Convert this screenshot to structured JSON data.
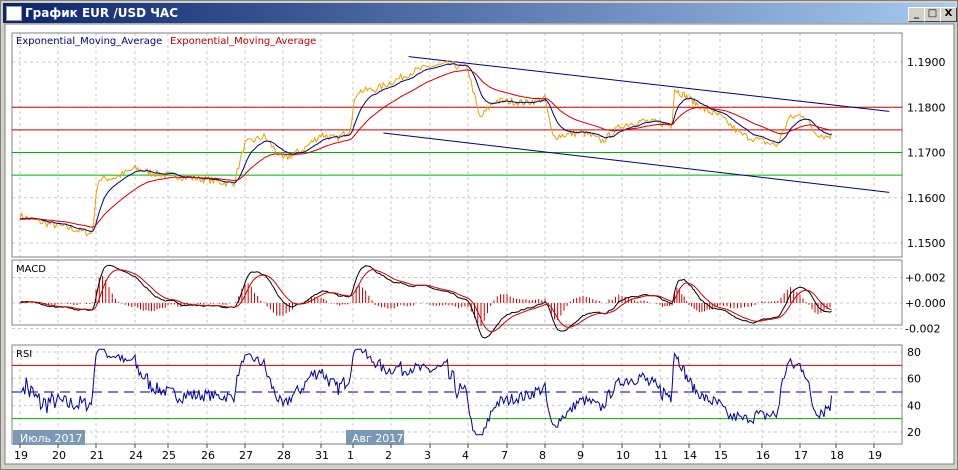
{
  "window": {
    "title": "График EUR /USD  ЧАС",
    "minimize": "_",
    "maximize": "□",
    "close": "X"
  },
  "legend": {
    "ema_blue": "Exponential_Moving_Average",
    "ema_red": "Exponential_Moving_Average"
  },
  "panels": {
    "macd": "MACD",
    "rsi": "RSI"
  },
  "months": [
    {
      "label": "Июль 2017"
    },
    {
      "label": "Авг 2017"
    }
  ],
  "colors": {
    "price": "#e8a000",
    "ema_fast": "#000080",
    "ema_slow": "#d00000",
    "red_level": "#d00000",
    "green_level": "#00b000",
    "channel": "#000080"
  },
  "chart_data": [
    {
      "type": "line",
      "title": "EUR/USD H1",
      "y_ticks": [
        "1.1900",
        "1.1800",
        "1.1700",
        "1.1600",
        "1.1500"
      ],
      "ylim": [
        1.1475,
        1.1965
      ],
      "x_ticks": [
        "19",
        "20",
        "21",
        "24",
        "25",
        "26",
        "27",
        "28",
        "31",
        "1",
        "2",
        "3",
        "4",
        "7",
        "8",
        "9",
        "10",
        "11",
        "14",
        "15",
        "16",
        "17",
        "18",
        "19"
      ],
      "price_keypoints": [
        [
          0,
          1.156
        ],
        [
          0.6,
          1.1545
        ],
        [
          1.2,
          1.1535
        ],
        [
          1.9,
          1.152
        ],
        [
          2.05,
          1.164
        ],
        [
          2.5,
          1.1645
        ],
        [
          3,
          1.1665
        ],
        [
          3.5,
          1.1655
        ],
        [
          4,
          1.165
        ],
        [
          5,
          1.164
        ],
        [
          5.7,
          1.163
        ],
        [
          6,
          1.172
        ],
        [
          6.5,
          1.1735
        ],
        [
          7,
          1.1685
        ],
        [
          7.5,
          1.1705
        ],
        [
          8,
          1.174
        ],
        [
          8.5,
          1.173
        ],
        [
          8.9,
          1.175
        ],
        [
          9.1,
          1.1835
        ],
        [
          9.6,
          1.184
        ],
        [
          10,
          1.1855
        ],
        [
          10.6,
          1.188
        ],
        [
          11,
          1.189
        ],
        [
          11.5,
          1.1895
        ],
        [
          12,
          1.1885
        ],
        [
          12.3,
          1.1775
        ],
        [
          12.7,
          1.1815
        ],
        [
          13.5,
          1.181
        ],
        [
          14,
          1.182
        ],
        [
          14.2,
          1.1735
        ],
        [
          15,
          1.1745
        ],
        [
          15.5,
          1.1725
        ],
        [
          16,
          1.176
        ],
        [
          16.5,
          1.177
        ],
        [
          17,
          1.1765
        ],
        [
          17.4,
          1.176
        ],
        [
          17.5,
          1.184
        ],
        [
          18,
          1.182
        ],
        [
          18.5,
          1.1795
        ],
        [
          19,
          1.178
        ],
        [
          19.5,
          1.174
        ],
        [
          20,
          1.1725
        ],
        [
          20.4,
          1.1715
        ],
        [
          20.7,
          1.1775
        ],
        [
          21.1,
          1.1785
        ],
        [
          21.4,
          1.1745
        ],
        [
          21.7,
          1.1735
        ],
        [
          21.9,
          1.1738
        ]
      ],
      "levels": [
        {
          "value": 1.18,
          "color": "red"
        },
        {
          "value": 1.175,
          "color": "red"
        },
        {
          "value": 1.17,
          "color": "green"
        },
        {
          "value": 1.165,
          "color": "green"
        }
      ],
      "channel": [
        [
          [
            10.45,
            1.1912
          ],
          [
            23.4,
            1.1791
          ]
        ],
        [
          [
            9.8,
            1.1743
          ],
          [
            23.4,
            1.1612
          ]
        ]
      ]
    },
    {
      "type": "line",
      "title": "MACD",
      "y_ticks": [
        "+0.002",
        "+0.000",
        "-0.002"
      ],
      "ylim": [
        -0.003,
        0.003
      ]
    },
    {
      "type": "line",
      "title": "RSI",
      "y_ticks": [
        "80",
        "60",
        "40",
        "20"
      ],
      "ylim": [
        15,
        85
      ],
      "levels": [
        70,
        50,
        30
      ]
    }
  ]
}
